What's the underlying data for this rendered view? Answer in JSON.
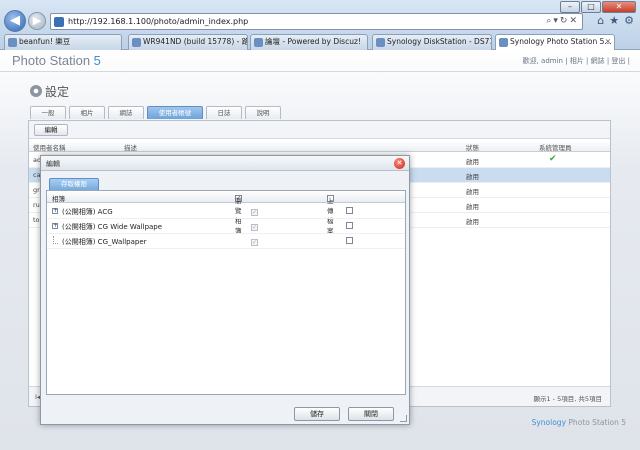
{
  "browser": {
    "url": "http://192.168.1.100/photo/admin_index.php",
    "window_buttons": [
      "–",
      "□",
      "✕"
    ],
    "tabs": [
      {
        "label": "beanfun! 樂豆"
      },
      {
        "label": "WR941ND (build 15778) - 路..."
      },
      {
        "label": "論壇 - Powered by Discuz!"
      },
      {
        "label": "Synology DiskStation - DS712"
      },
      {
        "label": "Synology Photo Station 5..."
      }
    ]
  },
  "app": {
    "logo_text": "Photo Station ",
    "logo_version": "5",
    "user_links": "歡迎, admin | 相片 | 網誌 | 登出 |",
    "page_title": "設定",
    "tabs": [
      "一般",
      "相片",
      "網誌",
      "使用者帳號",
      "日誌",
      "說明"
    ],
    "edit_button": "編輯",
    "columns": [
      "使用者名稱",
      "描述",
      "狀態",
      "系統管理員"
    ],
    "rows": [
      {
        "name": "ad",
        "status": "啟用",
        "admin": "✔"
      },
      {
        "name": "ca",
        "status": "啟用",
        "admin": ""
      },
      {
        "name": "gr",
        "status": "啟用",
        "admin": ""
      },
      {
        "name": "ru",
        "status": "啟用",
        "admin": ""
      },
      {
        "name": "to",
        "status": "啟用",
        "admin": ""
      }
    ],
    "pager_left": "I◀",
    "pager_text": "顯示1 - 5項目, 共5項目",
    "footer_brand": "Synology",
    "footer_product": " Photo Station 5"
  },
  "modal": {
    "title": "編輯",
    "tab": "存取權限",
    "columns": [
      "相簿",
      "瀏覽相簿",
      "上傳檔案"
    ],
    "albums": [
      {
        "name": "(公開相簿) ACG",
        "expandable": true,
        "browse": true,
        "upload": false
      },
      {
        "name": "(公開相簿) CG Wide Wallpape",
        "expandable": true,
        "browse": true,
        "upload": false
      },
      {
        "name": "(公開相簿) CG_Wallpaper",
        "expandable": false,
        "browse": true,
        "upload": false
      }
    ],
    "save_button": "儲存",
    "close_button": "關閉"
  }
}
